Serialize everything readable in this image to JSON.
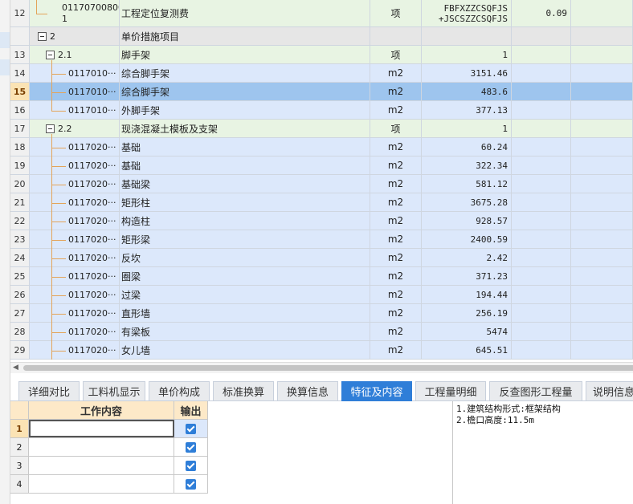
{
  "grid": {
    "rows": [
      {
        "num": "12",
        "code": "01170700800\n1",
        "name": "工程定位复测费",
        "unit": "项",
        "qty": "FBFXZZCSQFJS\n+JSCSZZCSQFJS",
        "extra": "0.09",
        "type": "green",
        "tree": "none"
      },
      {
        "num": "",
        "code": "2",
        "name": "单价措施项目",
        "unit": "",
        "qty": "",
        "extra": "",
        "type": "gray",
        "tree": "group"
      },
      {
        "num": "13",
        "code": "2.1",
        "name": "脚手架",
        "unit": "项",
        "qty": "1",
        "extra": "",
        "type": "green",
        "tree": "sub"
      },
      {
        "num": "14",
        "code": "0117010···",
        "name": "综合脚手架",
        "unit": "m2",
        "qty": "3151.46",
        "extra": "",
        "type": "blue",
        "tree": "leaf"
      },
      {
        "num": "15",
        "code": "0117010···",
        "name": "综合脚手架",
        "unit": "m2",
        "qty": "483.6",
        "extra": "",
        "type": "sel",
        "tree": "leaf"
      },
      {
        "num": "16",
        "code": "0117010···",
        "name": "外脚手架",
        "unit": "m2",
        "qty": "377.13",
        "extra": "",
        "type": "blue",
        "tree": "leaf-last"
      },
      {
        "num": "17",
        "code": "2.2",
        "name": "现浇混凝土模板及支架",
        "unit": "项",
        "qty": "1",
        "extra": "",
        "type": "green",
        "tree": "sub"
      },
      {
        "num": "18",
        "code": "0117020···",
        "name": "基础",
        "unit": "m2",
        "qty": "60.24",
        "extra": "",
        "type": "blue",
        "tree": "leaf"
      },
      {
        "num": "19",
        "code": "0117020···",
        "name": "基础",
        "unit": "m2",
        "qty": "322.34",
        "extra": "",
        "type": "blue",
        "tree": "leaf"
      },
      {
        "num": "20",
        "code": "0117020···",
        "name": "基础梁",
        "unit": "m2",
        "qty": "581.12",
        "extra": "",
        "type": "blue",
        "tree": "leaf"
      },
      {
        "num": "21",
        "code": "0117020···",
        "name": "矩形柱",
        "unit": "m2",
        "qty": "3675.28",
        "extra": "",
        "type": "blue",
        "tree": "leaf"
      },
      {
        "num": "22",
        "code": "0117020···",
        "name": "构造柱",
        "unit": "m2",
        "qty": "928.57",
        "extra": "",
        "type": "blue",
        "tree": "leaf"
      },
      {
        "num": "23",
        "code": "0117020···",
        "name": "矩形梁",
        "unit": "m2",
        "qty": "2400.59",
        "extra": "",
        "type": "blue",
        "tree": "leaf"
      },
      {
        "num": "24",
        "code": "0117020···",
        "name": "反坎",
        "unit": "m2",
        "qty": "2.42",
        "extra": "",
        "type": "blue",
        "tree": "leaf"
      },
      {
        "num": "25",
        "code": "0117020···",
        "name": "圈梁",
        "unit": "m2",
        "qty": "371.23",
        "extra": "",
        "type": "blue",
        "tree": "leaf"
      },
      {
        "num": "26",
        "code": "0117020···",
        "name": "过梁",
        "unit": "m2",
        "qty": "194.44",
        "extra": "",
        "type": "blue",
        "tree": "leaf"
      },
      {
        "num": "27",
        "code": "0117020···",
        "name": "直形墙",
        "unit": "m2",
        "qty": "256.19",
        "extra": "",
        "type": "blue",
        "tree": "leaf"
      },
      {
        "num": "28",
        "code": "0117020···",
        "name": "有梁板",
        "unit": "m2",
        "qty": "5474",
        "extra": "",
        "type": "blue",
        "tree": "leaf"
      },
      {
        "num": "29",
        "code": "0117020···",
        "name": "女儿墙",
        "unit": "m2",
        "qty": "645.51",
        "extra": "",
        "type": "blue",
        "tree": "leaf"
      }
    ]
  },
  "tabs": [
    {
      "label": "详细对比",
      "active": false
    },
    {
      "label": "工料机显示",
      "active": false
    },
    {
      "label": "单价构成",
      "active": false
    },
    {
      "label": "标准换算",
      "active": false
    },
    {
      "label": "换算信息",
      "active": false
    },
    {
      "label": "特征及内容",
      "active": true
    },
    {
      "label": "工程量明细",
      "active": false
    },
    {
      "label": "反查图形工程量",
      "active": false
    },
    {
      "label": "说明信息",
      "active": false
    }
  ],
  "content_table": {
    "header_work": "工作内容",
    "header_output": "输出",
    "rows": [
      {
        "num": "1",
        "work": "",
        "output": true,
        "selected": true
      },
      {
        "num": "2",
        "work": "",
        "output": true,
        "selected": false
      },
      {
        "num": "3",
        "work": "",
        "output": true,
        "selected": false
      },
      {
        "num": "4",
        "work": "",
        "output": true,
        "selected": false
      }
    ]
  },
  "features": {
    "lines": [
      "1.建筑结构形式:框架结构",
      "2.檐口高度:11.5m"
    ]
  },
  "colors": {
    "row_blue": "#dce8fb",
    "row_green": "#e8f4e3",
    "row_selected": "#9ec5ee",
    "tab_active": "#2f7ed8",
    "tree_line": "#e3a45a"
  }
}
